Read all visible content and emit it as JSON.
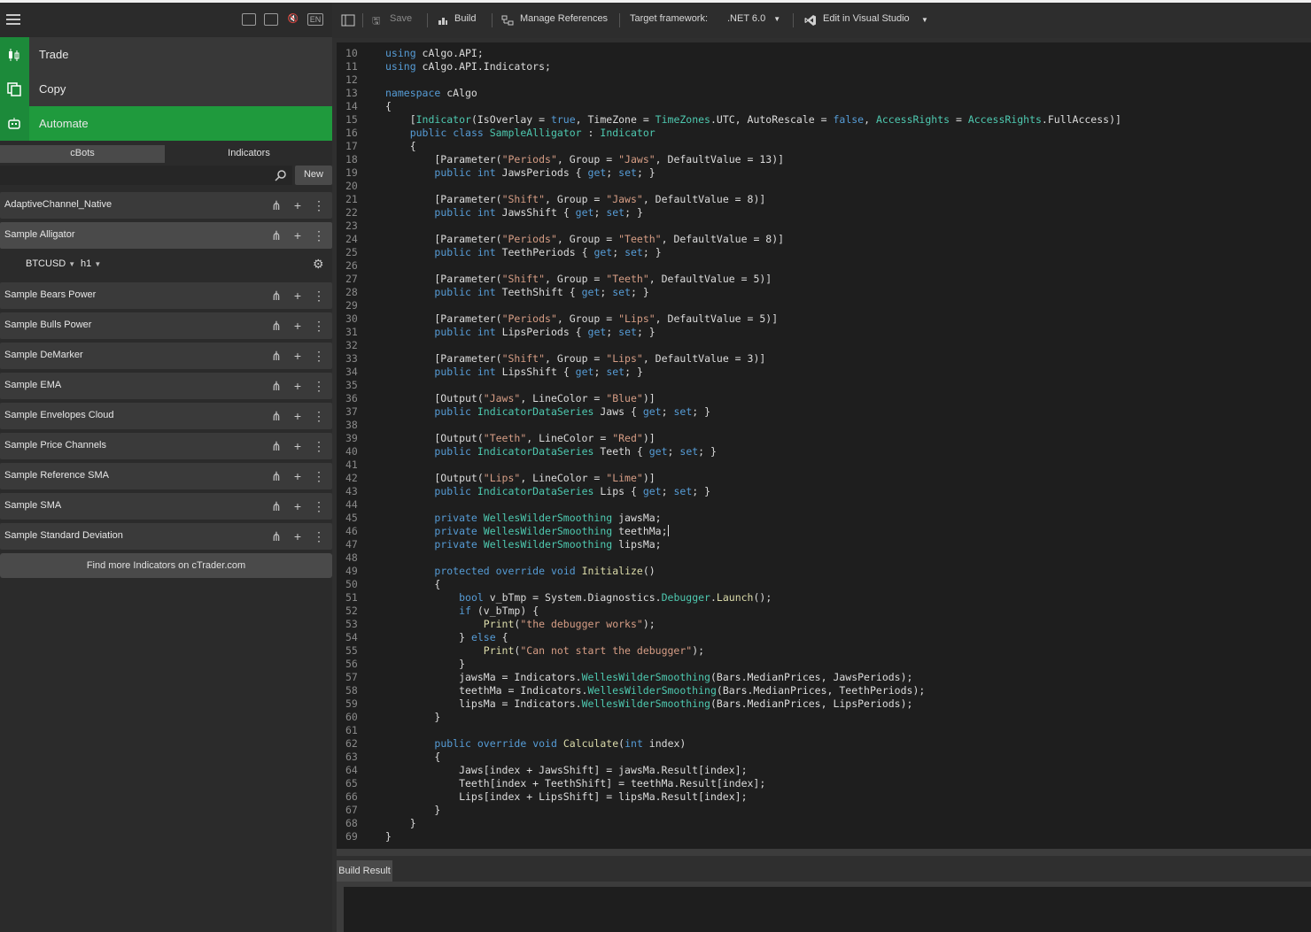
{
  "nav": {
    "items": [
      {
        "label": "Trade",
        "icon": "candlestick-icon"
      },
      {
        "label": "Copy",
        "icon": "copy-icon"
      },
      {
        "label": "Automate",
        "icon": "robot-icon"
      }
    ]
  },
  "tabs": {
    "cbots": "cBots",
    "indicators": "Indicators"
  },
  "search": {
    "placeholder": "",
    "new_label": "New"
  },
  "list": {
    "items": [
      "AdaptiveChannel_Native",
      "Sample Alligator",
      "Sample Bears Power",
      "Sample Bulls Power",
      "Sample DeMarker",
      "Sample EMA",
      "Sample Envelopes Cloud",
      "Sample Price Channels",
      "Sample Reference SMA",
      "Sample SMA",
      "Sample Standard Deviation"
    ],
    "instance": {
      "symbol": "BTCUSD",
      "timeframe": "h1"
    },
    "find_more": "Find more Indicators on cTrader.com"
  },
  "toolbar": {
    "save": "Save",
    "build": "Build",
    "manage_refs": "Manage References",
    "target_label": "Target framework:",
    "target_value": ".NET 6.0",
    "edit_vs": "Edit in Visual Studio"
  },
  "editor": {
    "first_line": 10,
    "lines": [
      "using cAlgo.API;",
      "using cAlgo.API.Indicators;",
      "",
      "namespace cAlgo",
      "{",
      "    [Indicator(IsOverlay = true, TimeZone = TimeZones.UTC, AutoRescale = false, AccessRights = AccessRights.FullAccess)]",
      "    public class SampleAlligator : Indicator",
      "    {",
      "        [Parameter(\"Periods\", Group = \"Jaws\", DefaultValue = 13)]",
      "        public int JawsPeriods { get; set; }",
      "",
      "        [Parameter(\"Shift\", Group = \"Jaws\", DefaultValue = 8)]",
      "        public int JawsShift { get; set; }",
      "",
      "        [Parameter(\"Periods\", Group = \"Teeth\", DefaultValue = 8)]",
      "        public int TeethPeriods { get; set; }",
      "",
      "        [Parameter(\"Shift\", Group = \"Teeth\", DefaultValue = 5)]",
      "        public int TeethShift { get; set; }",
      "",
      "        [Parameter(\"Periods\", Group = \"Lips\", DefaultValue = 5)]",
      "        public int LipsPeriods { get; set; }",
      "",
      "        [Parameter(\"Shift\", Group = \"Lips\", DefaultValue = 3)]",
      "        public int LipsShift { get; set; }",
      "",
      "        [Output(\"Jaws\", LineColor = \"Blue\")]",
      "        public IndicatorDataSeries Jaws { get; set; }",
      "",
      "        [Output(\"Teeth\", LineColor = \"Red\")]",
      "        public IndicatorDataSeries Teeth { get; set; }",
      "",
      "        [Output(\"Lips\", LineColor = \"Lime\")]",
      "        public IndicatorDataSeries Lips { get; set; }",
      "",
      "        private WellesWilderSmoothing jawsMa;",
      "        private WellesWilderSmoothing teethMa;",
      "        private WellesWilderSmoothing lipsMa;",
      "",
      "        protected override void Initialize()",
      "        {",
      "            bool v_bTmp = System.Diagnostics.Debugger.Launch();",
      "            if (v_bTmp) {",
      "                Print(\"the debugger works\");",
      "            } else {",
      "                Print(\"Can not start the debugger\");",
      "            }",
      "            jawsMa = Indicators.WellesWilderSmoothing(Bars.MedianPrices, JawsPeriods);",
      "            teethMa = Indicators.WellesWilderSmoothing(Bars.MedianPrices, TeethPeriods);",
      "            lipsMa = Indicators.WellesWilderSmoothing(Bars.MedianPrices, LipsPeriods);",
      "        }",
      "",
      "        public override void Calculate(int index)",
      "        {",
      "            Jaws[index + JawsShift] = jawsMa.Result[index];",
      "            Teeth[index + TeethShift] = teethMa.Result[index];",
      "            Lips[index + LipsShift] = lipsMa.Result[index];",
      "        }",
      "    }",
      "}"
    ]
  },
  "build_result": {
    "tab": "Build Result"
  }
}
